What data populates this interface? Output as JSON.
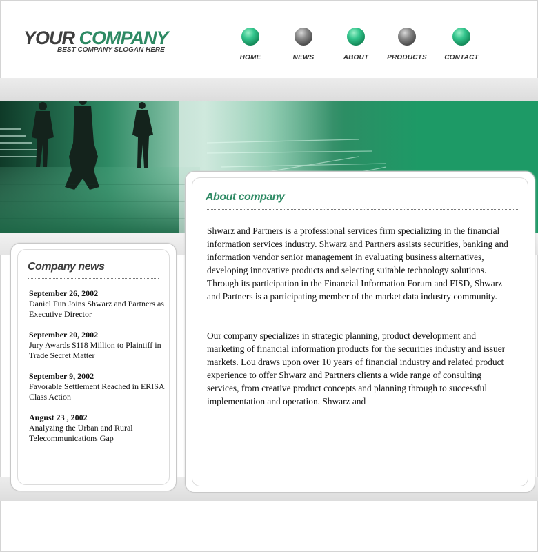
{
  "header": {
    "logo_your": "YOUR",
    "logo_company": "COMPANY",
    "slogan": "BEST COMPANY SLOGAN HERE"
  },
  "nav": [
    {
      "label": "HOME",
      "ball": "green"
    },
    {
      "label": "NEWS",
      "ball": "gray"
    },
    {
      "label": "ABOUT",
      "ball": "green"
    },
    {
      "label": "PRODUCTS",
      "ball": "gray"
    },
    {
      "label": "CONTACT",
      "ball": "green"
    }
  ],
  "colors": {
    "accent": "#2e8a64",
    "dark_text": "#3e3e3e"
  },
  "news": {
    "title": "Company news",
    "items": [
      {
        "date": "September 26, 2002",
        "text": "Daniel Fun Joins Shwarz and Partners as Executive Director"
      },
      {
        "date": "September 20, 2002",
        "text": "Jury Awards $118 Million to Plaintiff in Trade Secret Matter"
      },
      {
        "date": "September 9, 2002",
        "text": "Favorable Settlement Reached in ERISA Class Action"
      },
      {
        "date": "August 23 , 2002",
        "text": "Analyzing the Urban and Rural Telecommunications Gap"
      }
    ]
  },
  "about": {
    "title": "About company",
    "paragraphs": [
      "Shwarz and Partners is a professional services firm specializing in the financial information services industry. Shwarz and Partners assists securities, banking and information vendor senior management in evaluating business alternatives, developing innovative products and selecting suitable technology solutions. Through its participation in the Financial Information Forum and FISD, Shwarz and Partners is a participating member of the market data industry community.",
      "Our company specializes in strategic planning, product development and marketing of financial information products for the securities industry and issuer markets. Lou draws upon over 10 years of financial industry and related product experience to offer Shwarz and Partners clients a wide range of consulting services, from creative product concepts and planning through to successful implementation and operation. Shwarz and"
    ]
  }
}
